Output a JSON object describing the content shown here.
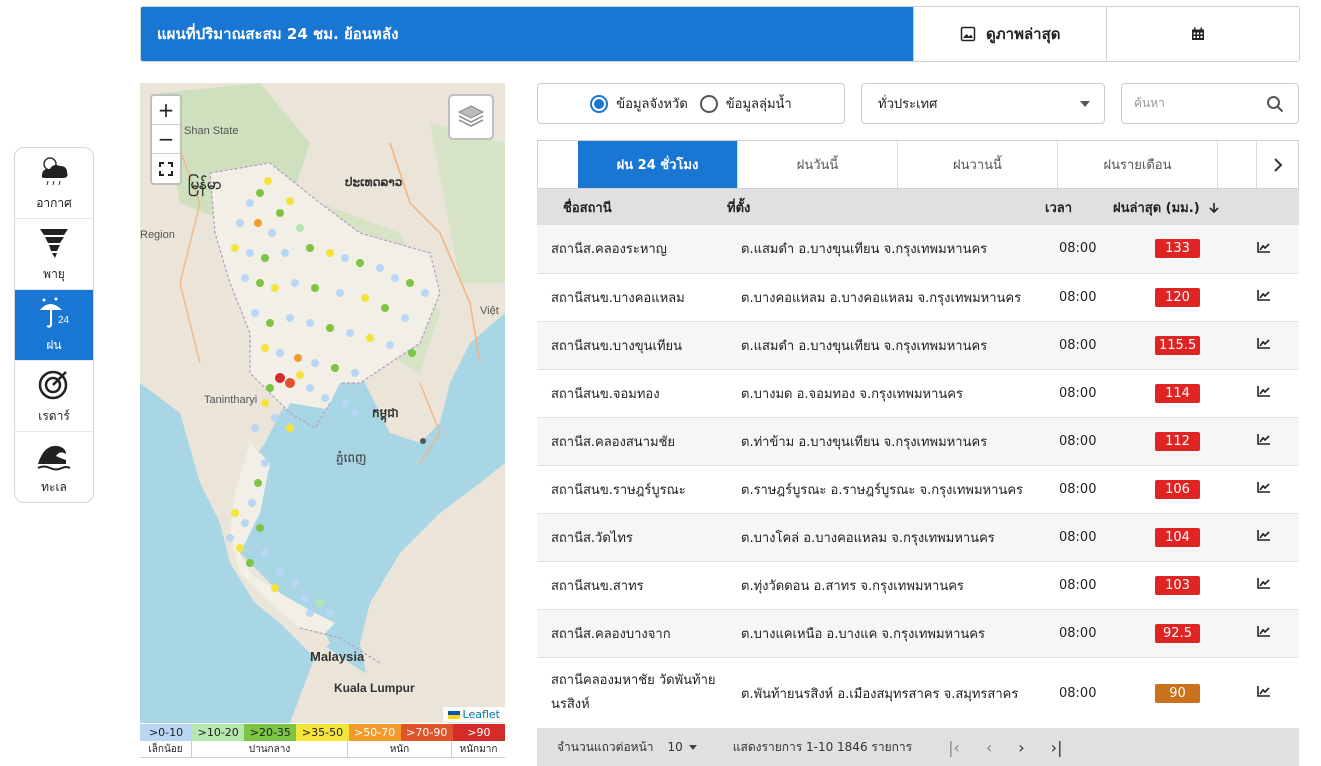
{
  "sidenav": [
    {
      "label": "อากาศ",
      "icon": "weather-cloud-icon",
      "active": false
    },
    {
      "label": "พายุ",
      "icon": "storm-tornado-icon",
      "active": false
    },
    {
      "label": "ฝน",
      "icon": "rain-24-icon",
      "active": true
    },
    {
      "label": "เรดาร์",
      "icon": "radar-icon",
      "active": false
    },
    {
      "label": "ทะเล",
      "icon": "sea-wave-icon",
      "active": false
    }
  ],
  "header": {
    "title": "แผนที่ปริมาณสะสม 24 ชม. ย้อนหลัง",
    "latest_image_label": "ดูภาพล่าสุด",
    "calendar_icon": "calendar-icon",
    "image_icon": "image-icon"
  },
  "map": {
    "zoom_in": "+",
    "zoom_out": "−",
    "attribution": "Leaflet",
    "labels": {
      "shan": "Shan State",
      "lao": "ປະເທດລາວ",
      "myanmar": "မြန်မာ",
      "region": "Region",
      "viet": "Việt",
      "khmer": "កម្ពុជា",
      "pnom": "ភ្នំពេញ",
      "tanintharyi": "Tanintharyi",
      "malaysia": "Malaysia",
      "kuala": "Kuala Lumpur"
    }
  },
  "legend": {
    "ranges": [
      {
        "label": ">0-10",
        "color": "#b9d7f5"
      },
      {
        "label": ">10-20",
        "color": "#b7e7b1"
      },
      {
        "label": ">20-35",
        "color": "#7cc443"
      },
      {
        "label": ">35-50",
        "color": "#f3e33b"
      },
      {
        "label": ">50-70",
        "color": "#f29a2c"
      },
      {
        "label": ">70-90",
        "color": "#e0542b"
      },
      {
        "label": ">90",
        "color": "#d62b2b"
      }
    ],
    "categories": [
      "เล็กน้อย",
      "ปานกลาง",
      "หนัก",
      "หนักมาก"
    ]
  },
  "filters": {
    "radio_province": "ข้อมูลจังหวัด",
    "radio_basin": "ข้อมูลลุ่มน้ำ",
    "region_select": "ทั่วประเทศ",
    "search_placeholder": "ค้นหา"
  },
  "tabs": [
    "ฝน 24 ชั่วโมง",
    "ฝนวันนี้",
    "ฝนวานนี้",
    "ฝนรายเดือน"
  ],
  "table": {
    "headers": {
      "station": "ชื่อสถานี",
      "location": "ที่ตั้ง",
      "time": "เวลา",
      "rain": "ฝนล่าสุด (มม.)"
    },
    "rows": [
      {
        "station": "สถานีส.คลองระหาญ",
        "location": "ต.แสมดำ อ.บางขุนเทียน จ.กรุงเทพมหานคร",
        "time": "08:00",
        "rain": "133",
        "color": "#e02424"
      },
      {
        "station": "สถานีสนข.บางคอแหลม",
        "location": "ต.บางคอแหลม อ.บางคอแหลม จ.กรุงเทพมหานคร",
        "time": "08:00",
        "rain": "120",
        "color": "#e02424"
      },
      {
        "station": "สถานีสนข.บางขุนเทียน",
        "location": "ต.แสมดำ อ.บางขุนเทียน จ.กรุงเทพมหานคร",
        "time": "08:00",
        "rain": "115.5",
        "color": "#e02424"
      },
      {
        "station": "สถานีสนข.จอมทอง",
        "location": "ต.บางมด อ.จอมทอง จ.กรุงเทพมหานคร",
        "time": "08:00",
        "rain": "114",
        "color": "#e02424"
      },
      {
        "station": "สถานีส.คลองสนามชัย",
        "location": "ต.ท่าข้าม อ.บางขุนเทียน จ.กรุงเทพมหานคร",
        "time": "08:00",
        "rain": "112",
        "color": "#e02424"
      },
      {
        "station": "สถานีสนข.ราษฎร์บูรณะ",
        "location": "ต.ราษฎร์บูรณะ อ.ราษฎร์บูรณะ จ.กรุงเทพมหานคร",
        "time": "08:00",
        "rain": "106",
        "color": "#e02424"
      },
      {
        "station": "สถานีส.วัดไทร",
        "location": "ต.บางโคล่ อ.บางคอแหลม จ.กรุงเทพมหานคร",
        "time": "08:00",
        "rain": "104",
        "color": "#e02424"
      },
      {
        "station": "สถานีสนข.สาทร",
        "location": "ต.ทุ่งวัดดอน อ.สาทร จ.กรุงเทพมหานคร",
        "time": "08:00",
        "rain": "103",
        "color": "#e02424"
      },
      {
        "station": "สถานีส.คลองบางจาก",
        "location": "ต.บางแคเหนือ อ.บางแค จ.กรุงเทพมหานคร",
        "time": "08:00",
        "rain": "92.5",
        "color": "#e02424"
      },
      {
        "station": "สถานีคลองมหาชัย วัดพันท้ายนรสิงห์",
        "location": "ต.พันท้ายนรสิงห์ อ.เมืองสมุทรสาคร จ.สมุทรสาคร",
        "time": "08:00",
        "rain": "90",
        "color": "#c9711b"
      }
    ]
  },
  "pager": {
    "rows_label": "จำนวนแถวต่อหน้า",
    "rows_value": "10",
    "range_text": "แสดงรายการ 1-10 1846 รายการ"
  }
}
